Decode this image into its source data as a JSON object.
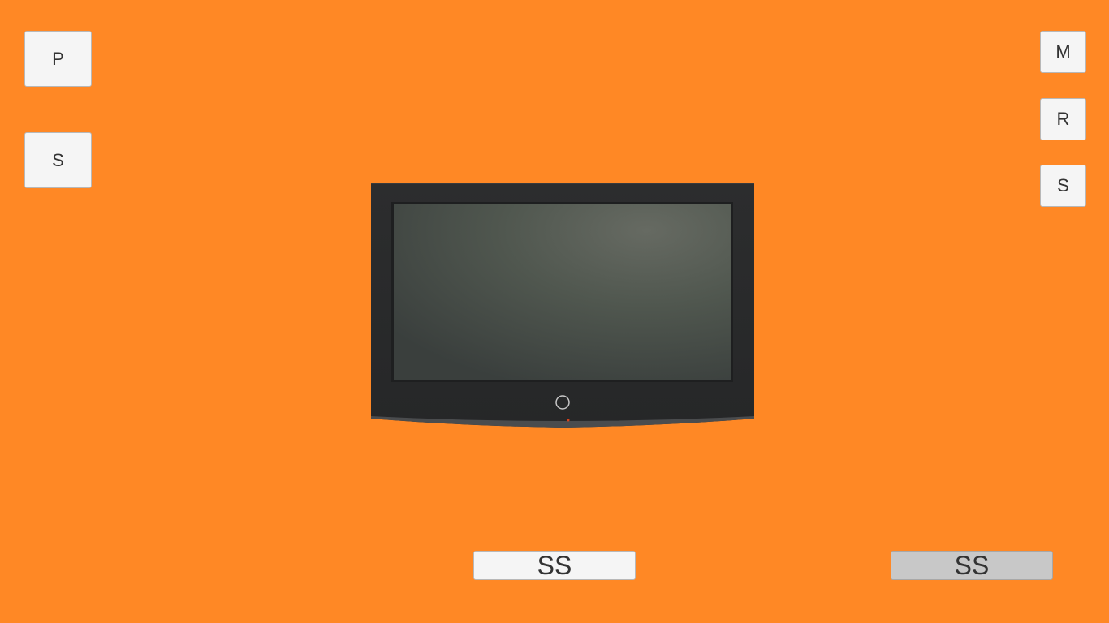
{
  "left_buttons": [
    {
      "label": "P"
    },
    {
      "label": "S"
    }
  ],
  "right_buttons": [
    {
      "label": "M"
    },
    {
      "label": "R"
    },
    {
      "label": "S"
    }
  ],
  "bottom_buttons": [
    {
      "label": "SS",
      "state": "enabled"
    },
    {
      "label": "SS",
      "state": "disabled"
    }
  ],
  "colors": {
    "background": "#FF8825",
    "button": "#F5F5F5",
    "button_disabled": "#C8C8C8",
    "tv_frame": "#2A2B2C",
    "tv_screen": "#4B524D"
  },
  "icons": {
    "tv": "television-icon",
    "power": "power-button-icon"
  }
}
